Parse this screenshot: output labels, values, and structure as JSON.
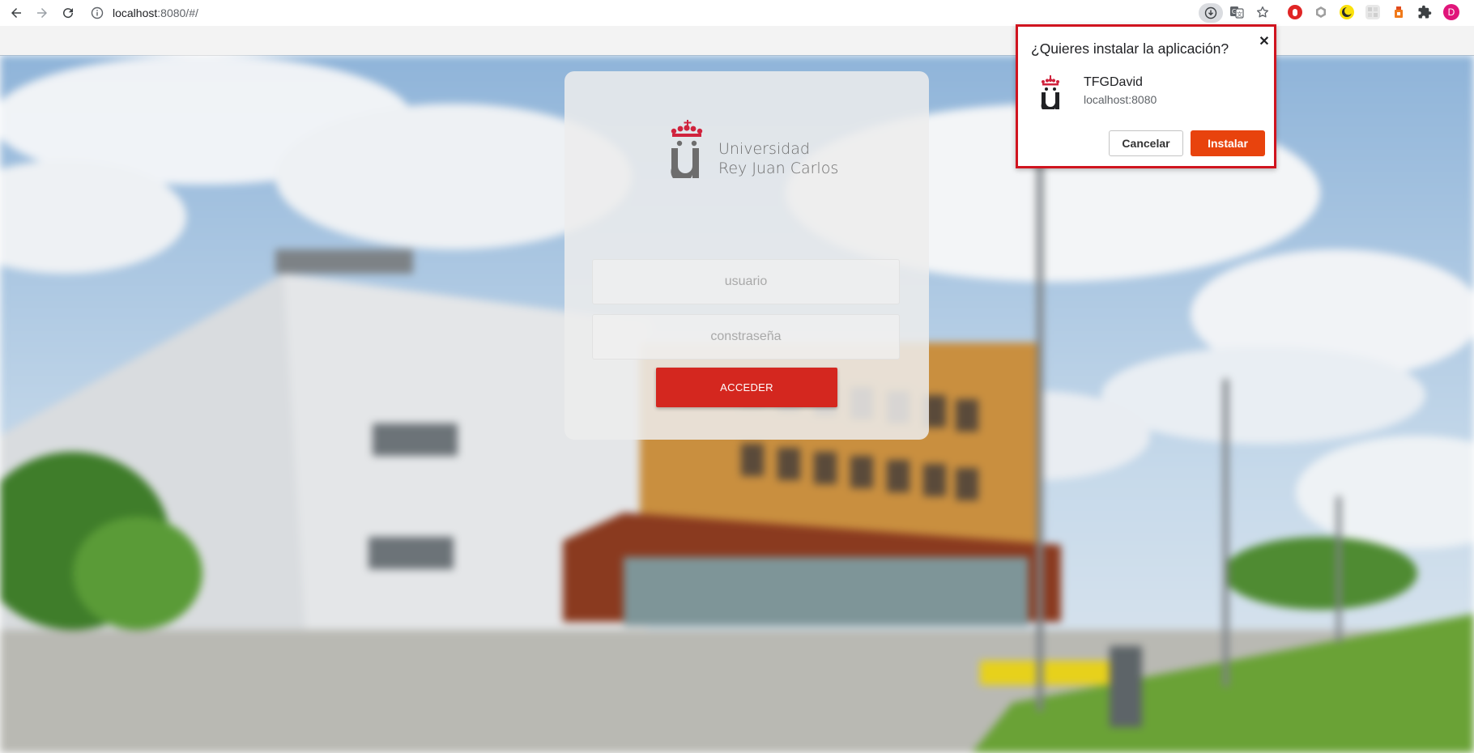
{
  "browser": {
    "url_host": "localhost",
    "url_rest": ":8080/#/",
    "profile_initial": "D",
    "icons": [
      "back-icon",
      "forward-icon",
      "reload-icon",
      "info-icon",
      "install-app-icon",
      "translate-icon",
      "star-icon",
      "extension-icon",
      "puzzle-icon",
      "avatar"
    ]
  },
  "login": {
    "logo_line1": "Universidad",
    "logo_line2": "Rey Juan Carlos",
    "username_placeholder": "usuario",
    "password_placeholder": "constraseña",
    "submit_label": "ACCEDER"
  },
  "install_prompt": {
    "title": "¿Quieres instalar la aplicación?",
    "close_label": "✕",
    "app_name": "TFGDavid",
    "app_origin": "localhost:8080",
    "cancel_label": "Cancelar",
    "install_label": "Instalar"
  },
  "colors": {
    "brand_red": "#d4271f",
    "install_orange": "#e8430d",
    "highlight_border": "#d0141f",
    "logo_crown": "#d0233d",
    "profile_pink": "#e0157a"
  }
}
